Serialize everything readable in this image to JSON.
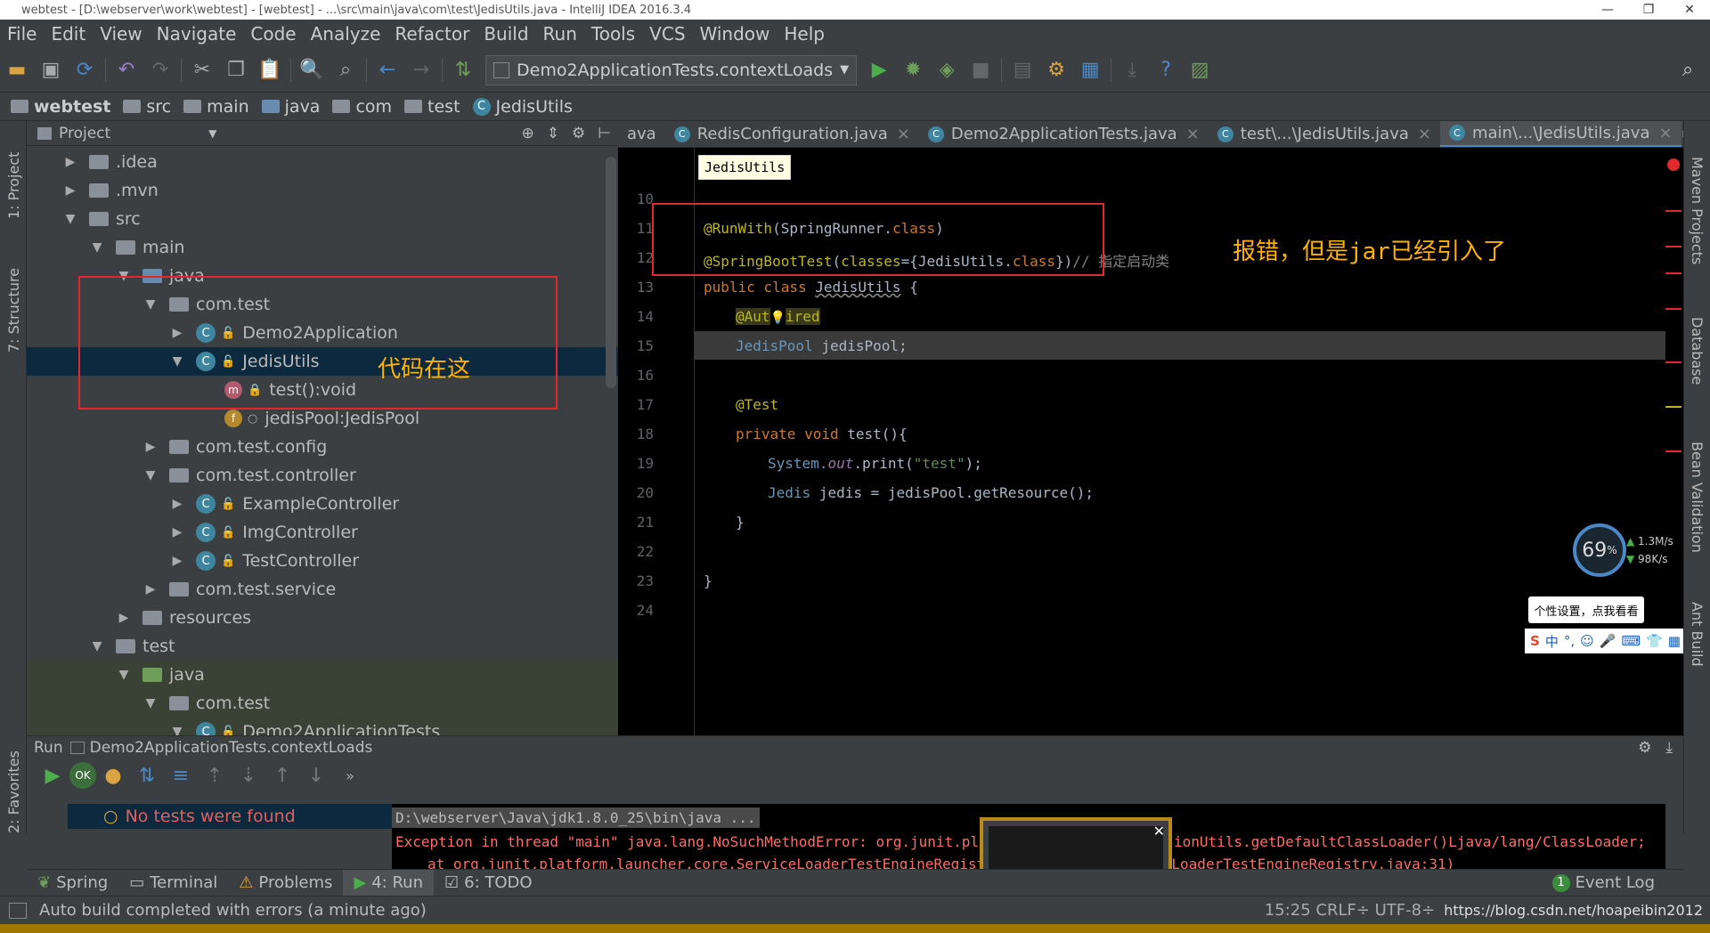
{
  "window": {
    "title": "webtest - [D:\\webserver\\work\\webtest] - [webtest] - ...\\src\\main\\java\\com\\test\\JedisUtils.java - IntelliJ IDEA 2016.3.4",
    "min": "—",
    "max": "❐",
    "close": "✕"
  },
  "menu": [
    "File",
    "Edit",
    "View",
    "Navigate",
    "Code",
    "Analyze",
    "Refactor",
    "Build",
    "Run",
    "Tools",
    "VCS",
    "Window",
    "Help"
  ],
  "toolbar": {
    "run_config": "Demo2ApplicationTests.contextLoads",
    "run_config_arrow": "▼"
  },
  "breadcrumb": [
    "webtest",
    "src",
    "main",
    "java",
    "com",
    "test",
    "JedisUtils"
  ],
  "leftstrip": {
    "project": "1: Project",
    "structure": "7: Structure",
    "favorites": "2: Favorites"
  },
  "rightstrip": {
    "maven": "Maven Projects",
    "database": "Database",
    "bean": "Bean Validation",
    "ant": "Ant Build"
  },
  "project": {
    "header": "Project",
    "tree": [
      {
        "label": ".idea",
        "expanded": false
      },
      {
        "label": ".mvn",
        "expanded": false
      },
      {
        "label": "src",
        "expanded": true
      },
      {
        "label": "main",
        "expanded": true
      },
      {
        "label": "java",
        "expanded": true
      },
      {
        "label": "com.test",
        "expanded": true
      },
      {
        "label": "Demo2Application",
        "expanded": false
      },
      {
        "label": "JedisUtils",
        "expanded": true
      },
      {
        "label": "test():void"
      },
      {
        "label": "jedisPool:JedisPool"
      },
      {
        "label": "com.test.config",
        "expanded": false
      },
      {
        "label": "com.test.controller",
        "expanded": true
      },
      {
        "label": "ExampleController",
        "expanded": false
      },
      {
        "label": "ImgController",
        "expanded": false
      },
      {
        "label": "TestController",
        "expanded": false
      },
      {
        "label": "com.test.service",
        "expanded": false
      },
      {
        "label": "resources",
        "expanded": false
      },
      {
        "label": "test",
        "expanded": true
      },
      {
        "label": "java",
        "expanded": true
      },
      {
        "label": "com.test",
        "expanded": true
      },
      {
        "label": "Demo2ApplicationTests",
        "expanded": true
      }
    ],
    "annotation": "代码在这"
  },
  "editor": {
    "tabs": [
      {
        "label": "ava",
        "active": false
      },
      {
        "label": "RedisConfiguration.java",
        "active": false
      },
      {
        "label": "Demo2ApplicationTests.java",
        "active": false
      },
      {
        "label": "test\\...\\JedisUtils.java",
        "active": false
      },
      {
        "label": "main\\...\\JedisUtils.java",
        "active": true
      }
    ],
    "tab_close": "×",
    "tab_menu": "≡2",
    "breadcrumb_tip": "JedisUtils",
    "line_numbers": [
      "10",
      "11",
      "12",
      "13",
      "14",
      "15",
      "16",
      "17",
      "18",
      "19",
      "20",
      "21",
      "22",
      "23",
      "24"
    ],
    "lines": {
      "l11": {
        "a": "@RunWith",
        "b": "(",
        "c": "SpringRunner",
        "d": ".",
        "e": "class",
        "f": ")"
      },
      "l12": {
        "a": "@SpringBootTest",
        "b": "(",
        "c": "classes",
        "d": "={",
        "e": "JedisUtils",
        "f": ".",
        "g": "class",
        "h": "})",
        "i": "// 指定启动类"
      },
      "l13": {
        "a": "public",
        "b": " class ",
        "c": "JedisUtils",
        "d": " {"
      },
      "l14": {
        "a": "@Aut",
        "b": "💡",
        "c": "ired"
      },
      "l15": {
        "a": "JedisPool",
        "b": " jedisPool;"
      },
      "l17": {
        "a": "@Test"
      },
      "l18": {
        "a": "private",
        "b": " ",
        "c": "void",
        "d": " test(){"
      },
      "l19": {
        "a": "System.",
        "b": "out",
        "c": ".print(",
        "d": "\"test\"",
        "e": ");"
      },
      "l20": {
        "a": "Jedis",
        "b": " jedis = jedisPool.getResource();"
      },
      "l21": {
        "a": "}"
      },
      "l23": {
        "a": "}"
      }
    },
    "annotation": "报错，但是jar已经引入了"
  },
  "run": {
    "title": "Run",
    "config": "Demo2ApplicationTests.contextLoads",
    "no_tests": "No tests were found",
    "console": [
      "D:\\webserver\\Java\\jdk1.8.0_25\\bin\\java ...",
      "Exception in thread \"main\" java.lang.NoSuchMethodError: org.junit.platf",
      "ionUtils.getDefaultClassLoader()Ljava/lang/ClassLoader;",
      "at org.junit.platform.launcher.core.ServiceLoaderTestEngineRegistry",
      "LoaderTestEngineRegistry.java:31)"
    ]
  },
  "bottomtabs": [
    "Spring",
    "Terminal",
    "Problems",
    "4: Run",
    "6: TODO"
  ],
  "event_log": {
    "count": "1",
    "label": "Event Log"
  },
  "status": {
    "message": "Auto build completed with errors (a minute ago)",
    "position": "15:25  CRLF÷  UTF-8÷",
    "watermark": "https://blog.csdn.net/hoapeibin2012"
  },
  "widget": {
    "percent": "69",
    "unit": "%",
    "up": "1.3",
    "up_unit": "M/s",
    "down": "98",
    "down_unit": "K/s",
    "ime_tip": "个性设置，点我看看",
    "ime_label": "中"
  }
}
